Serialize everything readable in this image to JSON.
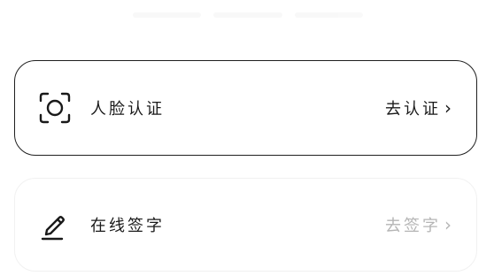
{
  "cards": [
    {
      "label": "人脸认证",
      "action_label": "去认证",
      "action_chevron": "›",
      "icon": "face-scan-icon",
      "state": "active"
    },
    {
      "label": "在线签字",
      "action_label": "去签字",
      "action_chevron": "›",
      "icon": "pen-icon",
      "state": "disabled"
    }
  ],
  "colors": {
    "text": "#1a1a1a",
    "muted": "#b5b5b5",
    "active_border": "#1f1f1f",
    "inactive_border": "#f1f1f1",
    "background": "#ffffff"
  }
}
